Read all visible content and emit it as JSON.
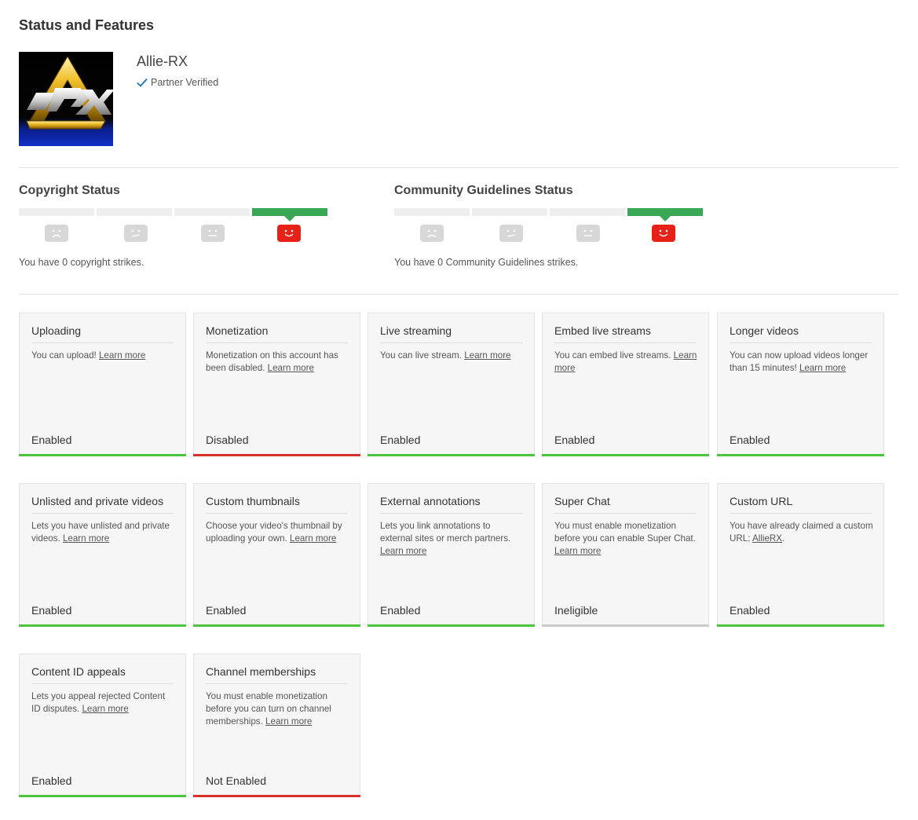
{
  "page": {
    "title": "Status and Features"
  },
  "channel": {
    "name": "Allie-RX",
    "verified_label": "Partner Verified"
  },
  "copyright": {
    "title": "Copyright Status",
    "text": "You have 0 copyright strikes."
  },
  "community": {
    "title": "Community Guidelines Status",
    "text": "You have 0 Community Guidelines strikes."
  },
  "colors": {
    "enabled": "#4cc43f",
    "disabled": "#d9302c",
    "ineligible": "#cccccc",
    "strike_active": "#3aa757",
    "face_good": "#e62117",
    "face_neutral": "#d7d7d7"
  },
  "cards": [
    {
      "title": "Uploading",
      "desc": "You can upload!",
      "link": "Learn more",
      "status": "Enabled",
      "state": "enabled"
    },
    {
      "title": "Monetization",
      "desc": "Monetization on this account has been disabled.",
      "link": "Learn more",
      "status": "Disabled",
      "state": "disabled"
    },
    {
      "title": "Live streaming",
      "desc": "You can live stream.",
      "link": "Learn more",
      "status": "Enabled",
      "state": "enabled"
    },
    {
      "title": "Embed live streams",
      "desc": "You can embed live streams.",
      "link": "Learn more",
      "status": "Enabled",
      "state": "enabled"
    },
    {
      "title": "Longer videos",
      "desc": "You can now upload videos longer than 15 minutes!",
      "link": "Learn more",
      "status": "Enabled",
      "state": "enabled"
    },
    {
      "title": "Unlisted and private videos",
      "desc": "Lets you have unlisted and private videos.",
      "link": "Learn more",
      "status": "Enabled",
      "state": "enabled"
    },
    {
      "title": "Custom thumbnails",
      "desc": "Choose your video's thumbnail by uploading your own.",
      "link": "Learn more",
      "status": "Enabled",
      "state": "enabled"
    },
    {
      "title": "External annotations",
      "desc": "Lets you link annotations to external sites or merch partners.",
      "link": "Learn more",
      "status": "Enabled",
      "state": "enabled"
    },
    {
      "title": "Super Chat",
      "desc": "You must enable monetization before you can enable Super Chat.",
      "link": "Learn more",
      "status": "Ineligible",
      "state": "ineligible"
    },
    {
      "title": "Custom URL",
      "desc": "You have already claimed a custom URL:",
      "link": "AllieRX",
      "suffix": ".",
      "status": "Enabled",
      "state": "enabled"
    },
    {
      "title": "Content ID appeals",
      "desc": "Lets you appeal rejected Content ID disputes.",
      "link": "Learn more",
      "status": "Enabled",
      "state": "enabled"
    },
    {
      "title": "Channel memberships",
      "desc": "You must enable monetization before you can turn on channel memberships.",
      "link": "Learn more",
      "status": "Not Enabled",
      "state": "disabled"
    }
  ]
}
